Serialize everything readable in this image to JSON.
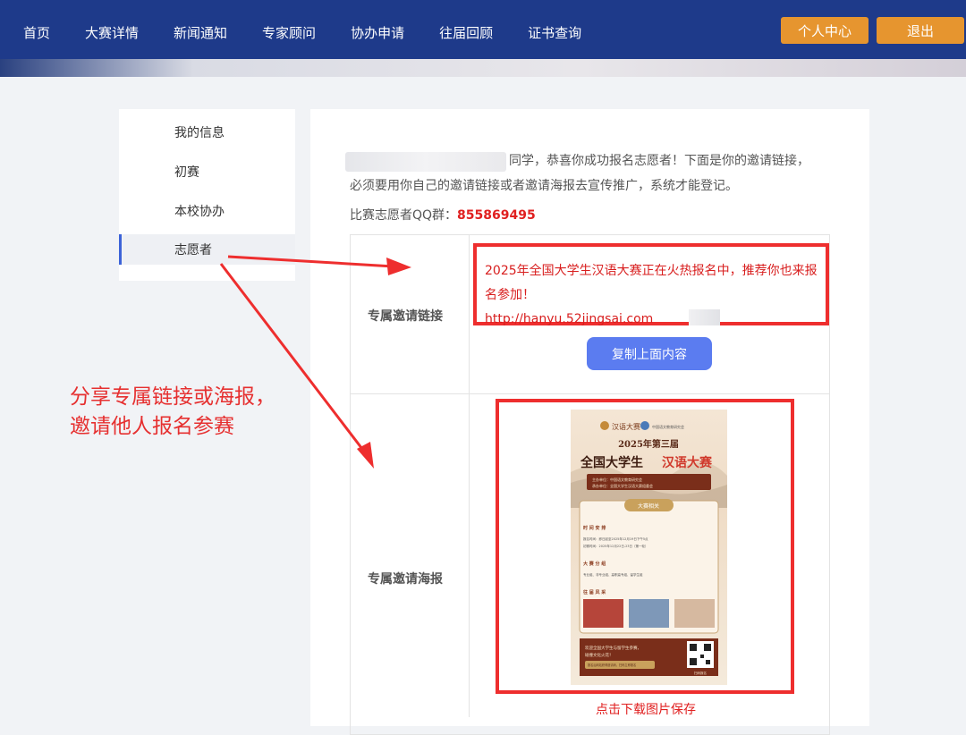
{
  "nav": {
    "items": [
      "首页",
      "大赛详情",
      "新闻通知",
      "专家顾问",
      "协办申请",
      "往届回顾",
      "证书查询"
    ],
    "personal_center": "个人中心",
    "logout": "退出"
  },
  "sidebar": {
    "items": [
      {
        "label": "我的信息"
      },
      {
        "label": "初赛"
      },
      {
        "label": "本校协办"
      },
      {
        "label": "志愿者"
      }
    ],
    "active_index": 3
  },
  "main": {
    "intro_line1": "同学，恭喜你成功报名志愿者！下面是你的邀请链接，",
    "intro_line2": "必须要用你自己的邀请链接或者邀请海报去宣传推广，系统才能登记。",
    "qq_label": "比赛志愿者QQ群：",
    "qq_number": "855869495",
    "invite_link_label": "专属邀请链接",
    "invite_text": "2025年全国大学生汉语大赛正在火热报名中，推荐你也来报名参加！",
    "invite_url": "http://hanyu.52jingsai.com",
    "copy_button": "复制上面内容",
    "invite_poster_label": "专属邀请海报",
    "download_text": "点击下载图片保存"
  },
  "poster": {
    "brand": "汉语大赛",
    "org": "中国语文教育研究会",
    "edition": "2025年第三届",
    "title_a": "全国大学生",
    "title_b": "汉语大赛",
    "host_line1": "主办单位：中国语文教育研究会",
    "host_line2": "承办单位：全国大学生汉语大赛组委会",
    "section_badge": "大赛相关",
    "schedule_head": "时 间 安 排",
    "schedule_1": "报名时间：即日起至2025年12月19日下午5点",
    "schedule_2": "初赛时间：2025年12月22日-23日（第一轮）",
    "groups_head": "大 赛 分 组",
    "groups_text": "专业组、非专业组、高职高专组、留学生组",
    "showcase_head": "往 届 风 采",
    "footer_line1": "欢迎全国大学生与留学生参赛，",
    "footer_line2": "碰撞文化火花！",
    "footer_cta": "报名后网站获得邀请码，扫码立即报名",
    "qr_label": "扫码报名"
  },
  "annotation": {
    "line1": "分享专属链接或海报，",
    "line2": "邀请他人报名参赛"
  },
  "colors": {
    "nav_bg": "#1e3a8a",
    "orange": "#e6952f",
    "highlight_red": "#ee2e2e",
    "accent_blue": "#5b7cf0"
  }
}
